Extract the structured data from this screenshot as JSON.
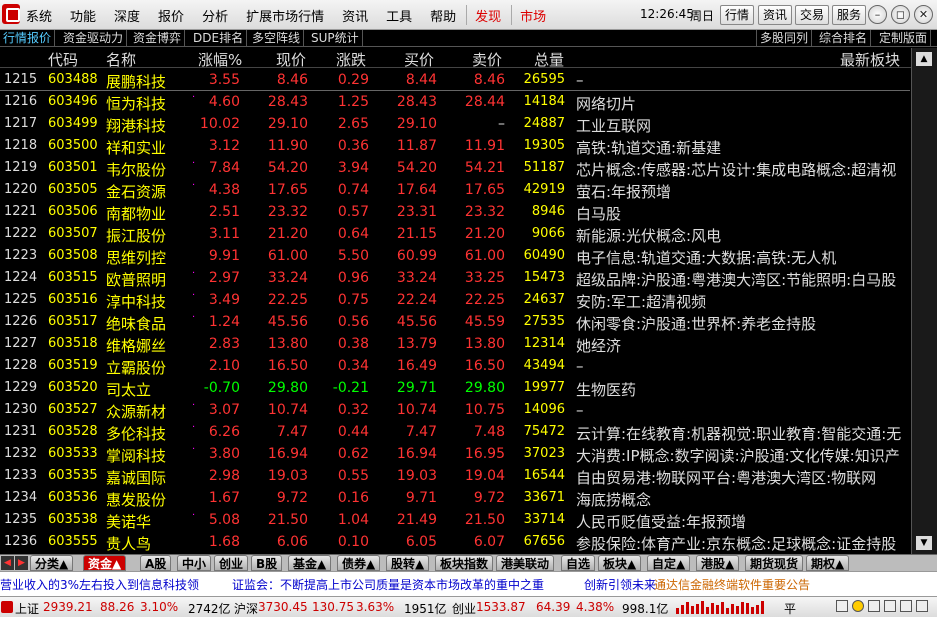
{
  "menu": {
    "items": [
      "系统",
      "功能",
      "深度",
      "报价",
      "分析",
      "扩展市场行情",
      "资讯",
      "工具",
      "帮助"
    ],
    "highlight1": "发现",
    "highlight2": "市场"
  },
  "topright": {
    "time": "12:26:45",
    "weekday": "周日",
    "buttons": [
      "行情",
      "资讯",
      "交易",
      "服务"
    ]
  },
  "subtabs": {
    "left": [
      "行情报价",
      "资金驱动力",
      "资金博弈",
      "DDE排名",
      "多空阵线",
      "SUP统计"
    ],
    "right": [
      "多股同列",
      "综合排名",
      "定制版面"
    ]
  },
  "headers": [
    "代码",
    "名称",
    "涨幅%",
    "现价",
    "涨跌",
    "买价",
    "卖价",
    "总量",
    "最新板块"
  ],
  "rows": [
    {
      "n": "1215",
      "code": "603488",
      "name": "展鹏科技",
      "dot": "",
      "pct": "3.55",
      "price": "8.46",
      "chg": "0.29",
      "buy": "8.44",
      "sell": "8.46",
      "vol": "26595",
      "sector": "–",
      "dir": "up"
    },
    {
      "n": "1216",
      "code": "603496",
      "name": "恒为科技",
      "dot": "·",
      "pct": "4.60",
      "price": "28.43",
      "chg": "1.25",
      "buy": "28.43",
      "sell": "28.44",
      "vol": "14184",
      "sector": "网络切片",
      "dir": "up"
    },
    {
      "n": "1217",
      "code": "603499",
      "name": "翔港科技",
      "dot": "",
      "pct": "10.02",
      "price": "29.10",
      "chg": "2.65",
      "buy": "29.10",
      "sell": "–",
      "vol": "24887",
      "sector": "工业互联网",
      "dir": "up"
    },
    {
      "n": "1218",
      "code": "603500",
      "name": "祥和实业",
      "dot": "",
      "pct": "3.12",
      "price": "11.90",
      "chg": "0.36",
      "buy": "11.87",
      "sell": "11.91",
      "vol": "19305",
      "sector": "高铁:轨道交通:新基建",
      "dir": "up"
    },
    {
      "n": "1219",
      "code": "603501",
      "name": "韦尔股份",
      "dot": "·",
      "pct": "7.84",
      "price": "54.20",
      "chg": "3.94",
      "buy": "54.20",
      "sell": "54.21",
      "vol": "51187",
      "sector": "芯片概念:传感器:芯片设计:集成电路概念:超清视",
      "dir": "up"
    },
    {
      "n": "1220",
      "code": "603505",
      "name": "金石资源",
      "dot": "·",
      "pct": "4.38",
      "price": "17.65",
      "chg": "0.74",
      "buy": "17.64",
      "sell": "17.65",
      "vol": "42919",
      "sector": "萤石:年报预增",
      "dir": "up"
    },
    {
      "n": "1221",
      "code": "603506",
      "name": "南都物业",
      "dot": "",
      "pct": "2.51",
      "price": "23.32",
      "chg": "0.57",
      "buy": "23.31",
      "sell": "23.32",
      "vol": "8946",
      "sector": "白马股",
      "dir": "up"
    },
    {
      "n": "1222",
      "code": "603507",
      "name": "振江股份",
      "dot": "",
      "pct": "3.11",
      "price": "21.20",
      "chg": "0.64",
      "buy": "21.15",
      "sell": "21.20",
      "vol": "9066",
      "sector": "新能源:光伏概念:风电",
      "dir": "up"
    },
    {
      "n": "1223",
      "code": "603508",
      "name": "思维列控",
      "dot": "",
      "pct": "9.91",
      "price": "61.00",
      "chg": "5.50",
      "buy": "60.99",
      "sell": "61.00",
      "vol": "60490",
      "sector": "电子信息:轨道交通:大数据:高铁:无人机",
      "dir": "up"
    },
    {
      "n": "1224",
      "code": "603515",
      "name": "欧普照明",
      "dot": "·",
      "pct": "2.97",
      "price": "33.24",
      "chg": "0.96",
      "buy": "33.24",
      "sell": "33.25",
      "vol": "15473",
      "sector": "超级品牌:沪股通:粤港澳大湾区:节能照明:白马股",
      "dir": "up"
    },
    {
      "n": "1225",
      "code": "603516",
      "name": "淳中科技",
      "dot": "·",
      "pct": "3.49",
      "price": "22.25",
      "chg": "0.75",
      "buy": "22.24",
      "sell": "22.25",
      "vol": "24637",
      "sector": "安防:军工:超清视频",
      "dir": "up"
    },
    {
      "n": "1226",
      "code": "603517",
      "name": "绝味食品",
      "dot": "·",
      "pct": "1.24",
      "price": "45.56",
      "chg": "0.56",
      "buy": "45.56",
      "sell": "45.59",
      "vol": "27535",
      "sector": "休闲零食:沪股通:世界杯:养老金持股",
      "dir": "up"
    },
    {
      "n": "1227",
      "code": "603518",
      "name": "维格娜丝",
      "dot": "",
      "pct": "2.83",
      "price": "13.80",
      "chg": "0.38",
      "buy": "13.79",
      "sell": "13.80",
      "vol": "12314",
      "sector": "她经济",
      "dir": "up"
    },
    {
      "n": "1228",
      "code": "603519",
      "name": "立霸股份",
      "dot": "",
      "pct": "2.10",
      "price": "16.50",
      "chg": "0.34",
      "buy": "16.49",
      "sell": "16.50",
      "vol": "43494",
      "sector": "–",
      "dir": "up"
    },
    {
      "n": "1229",
      "code": "603520",
      "name": "司太立",
      "dot": "",
      "pct": "-0.70",
      "price": "29.80",
      "chg": "-0.21",
      "buy": "29.71",
      "sell": "29.80",
      "vol": "19977",
      "sector": "生物医药",
      "dir": "dn"
    },
    {
      "n": "1230",
      "code": "603527",
      "name": "众源新材",
      "dot": "·",
      "pct": "3.07",
      "price": "10.74",
      "chg": "0.32",
      "buy": "10.74",
      "sell": "10.75",
      "vol": "14096",
      "sector": "–",
      "dir": "up"
    },
    {
      "n": "1231",
      "code": "603528",
      "name": "多伦科技",
      "dot": "·",
      "pct": "6.26",
      "price": "7.47",
      "chg": "0.44",
      "buy": "7.47",
      "sell": "7.48",
      "vol": "75472",
      "sector": "云计算:在线教育:机器视觉:职业教育:智能交通:无",
      "dir": "up"
    },
    {
      "n": "1232",
      "code": "603533",
      "name": "掌阅科技",
      "dot": "·",
      "pct": "3.80",
      "price": "16.94",
      "chg": "0.62",
      "buy": "16.94",
      "sell": "16.95",
      "vol": "37023",
      "sector": "大消费:IP概念:数字阅读:沪股通:文化传媒:知识产",
      "dir": "up"
    },
    {
      "n": "1233",
      "code": "603535",
      "name": "嘉诚国际",
      "dot": "",
      "pct": "2.98",
      "price": "19.03",
      "chg": "0.55",
      "buy": "19.03",
      "sell": "19.04",
      "vol": "16544",
      "sector": "自由贸易港:物联网平台:粤港澳大湾区:物联网",
      "dir": "up"
    },
    {
      "n": "1234",
      "code": "603536",
      "name": "惠发股份",
      "dot": "",
      "pct": "1.67",
      "price": "9.72",
      "chg": "0.16",
      "buy": "9.71",
      "sell": "9.72",
      "vol": "33671",
      "sector": "海底捞概念",
      "dir": "up"
    },
    {
      "n": "1235",
      "code": "603538",
      "name": "美诺华",
      "dot": "·",
      "pct": "5.08",
      "price": "21.50",
      "chg": "1.04",
      "buy": "21.49",
      "sell": "21.50",
      "vol": "33714",
      "sector": "人民币贬值受益:年报预增",
      "dir": "up"
    },
    {
      "n": "1236",
      "code": "603555",
      "name": "贵人鸟",
      "dot": "",
      "pct": "1.68",
      "price": "6.06",
      "chg": "0.10",
      "buy": "6.05",
      "sell": "6.07",
      "vol": "67656",
      "sector": "参股保险:体育产业:京东概念:足球概念:证金持股",
      "dir": "up"
    }
  ],
  "bottabs": [
    "分类▲",
    "资金▲",
    "A股",
    "中小",
    "创业",
    "B股",
    "基金▲",
    "债券▲",
    "股转▲",
    "板块指数",
    "港美联动",
    "自选",
    "板块▲",
    "自定▲",
    "港股▲",
    "期货现货",
    "期权▲"
  ],
  "news": [
    {
      "text": "营业收入的3%左右投入到信息科技领",
      "color": "#00c"
    },
    {
      "text": "证监会：不断提高上市公司质量是资本市场改革的重中之重",
      "color": "#00c"
    },
    {
      "text": "创新引领未来",
      "color": "#00c"
    },
    {
      "text": "通达信金融终端软件重要公告",
      "color": "#c60"
    }
  ],
  "status": {
    "sh": {
      "label": "上证",
      "val": "2939.21",
      "chg": "88.26",
      "pct": "3.10%",
      "amt": "2742亿"
    },
    "sz": {
      "label": "沪深",
      "val": "3730.45",
      "chg": "130.75",
      "pct": "3.63%",
      "amt": "1951亿"
    },
    "cy": {
      "label": "创业",
      "val": "1533.87",
      "chg": "64.39",
      "pct": "4.38%",
      "amt": "998.1亿"
    },
    "flat": "平"
  }
}
